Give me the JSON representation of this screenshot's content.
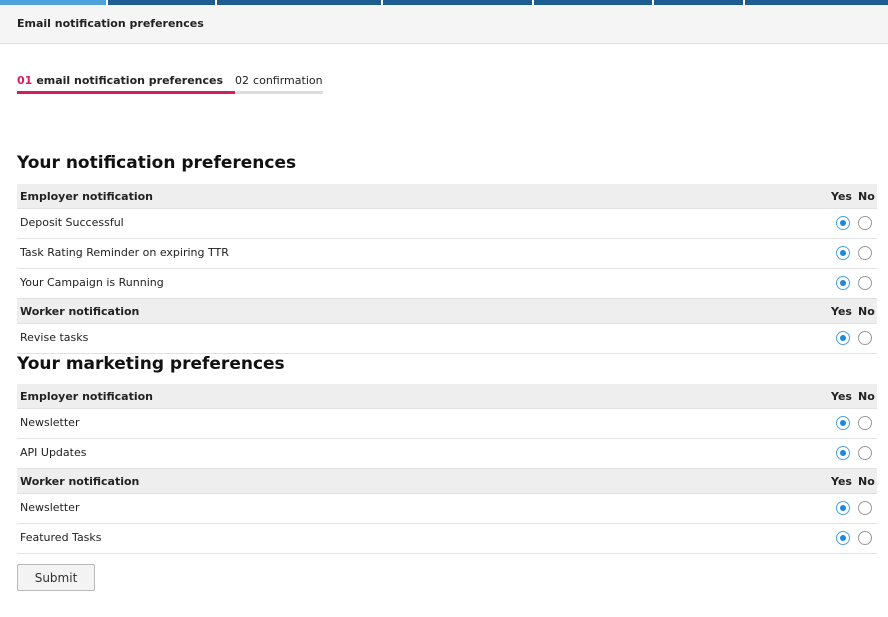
{
  "header": {
    "title": "Email notification preferences"
  },
  "steps": [
    {
      "num": "01",
      "label": "email notification preferences"
    },
    {
      "num": "02",
      "label": "confirmation"
    }
  ],
  "notification_section": {
    "title": "Your notification preferences",
    "employer": {
      "heading": "Employer notification",
      "yes": "Yes",
      "no": "No",
      "rows": [
        {
          "label": "Deposit Successful",
          "value": "yes"
        },
        {
          "label": "Task Rating Reminder on expiring TTR",
          "value": "yes"
        },
        {
          "label": "Your Campaign is Running",
          "value": "yes"
        }
      ]
    },
    "worker": {
      "heading": "Worker notification",
      "yes": "Yes",
      "no": "No",
      "rows": [
        {
          "label": "Revise tasks",
          "value": "yes"
        }
      ]
    }
  },
  "marketing_section": {
    "title": "Your marketing preferences",
    "employer": {
      "heading": "Employer notification",
      "yes": "Yes",
      "no": "No",
      "rows": [
        {
          "label": "Newsletter",
          "value": "yes"
        },
        {
          "label": "API Updates",
          "value": "yes"
        }
      ]
    },
    "worker": {
      "heading": "Worker notification",
      "yes": "Yes",
      "no": "No",
      "rows": [
        {
          "label": "Newsletter",
          "value": "yes"
        },
        {
          "label": "Featured Tasks",
          "value": "yes"
        }
      ]
    }
  },
  "submit_label": "Submit",
  "colors": {
    "accent": "#d81b5c",
    "radio_selected": "#1e88d8",
    "topbar": "#1d5d92",
    "topbar_active": "#4ea1da"
  }
}
